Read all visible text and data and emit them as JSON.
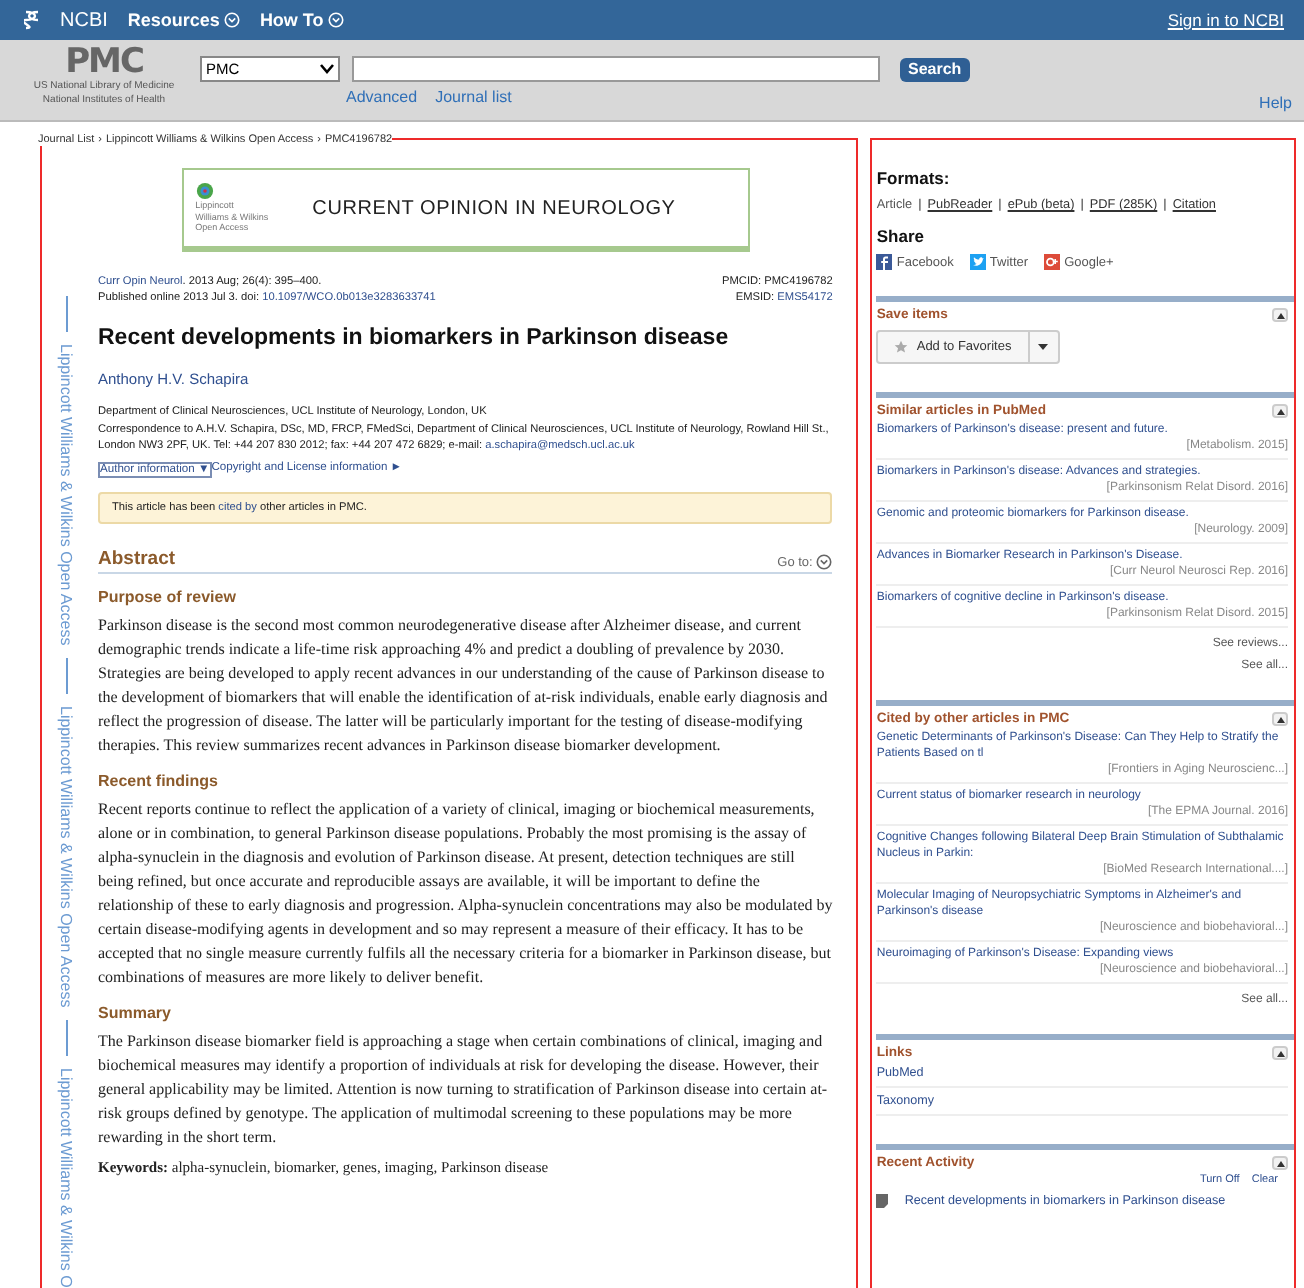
{
  "top_bar": {
    "brand": "NCBI",
    "menus": [
      "Resources",
      "How To"
    ],
    "sign_in": "Sign in to NCBI"
  },
  "search_bar": {
    "logo": "PMC",
    "org_lines": [
      "US National Library of Medicine",
      "National Institutes of Health"
    ],
    "database": "PMC",
    "button": "Search",
    "links": [
      "Advanced",
      "Journal list"
    ],
    "help": "Help"
  },
  "breadcrumb": {
    "items": [
      "Journal List",
      "Lippincott Williams & Wilkins Open Access",
      "PMC4196782"
    ],
    "separator": "›"
  },
  "side_strip": [
    "Lippincott Williams & Wilkins Open Access",
    "Lippincott Williams & Wilkins Open Access",
    "Lippincott Williams & Wilkins O"
  ],
  "banner": {
    "publisher_lines": [
      "Lippincott",
      "Williams & Wilkins",
      "Open Access"
    ],
    "journal": "CURRENT OPINION IN NEUROLOGY"
  },
  "citation": {
    "journal_link": "Curr Opin Neurol",
    "details": ". 2013 Aug; 26(4): 395–400.",
    "published": "Published online 2013 Jul 3. doi: ",
    "doi": "10.1097/WCO.0b013e3283633741",
    "pmcid": "PMCID: PMC4196782",
    "emsid_label": "EMSID: ",
    "emsid": "EMS54172"
  },
  "article": {
    "title": "Recent developments in biomarkers in Parkinson disease",
    "author": "Anthony H.V. Schapira",
    "affiliation": "Department of Clinical Neurosciences, UCL Institute of Neurology, London, UK",
    "correspondence": "Correspondence to A.H.V. Schapira, DSc, MD, FRCP, FMedSci, Department of Clinical Neurosciences, UCL Institute of Neurology, Rowland Hill St., London NW3 2PF, UK. Tel: +44 207 830 2012; fax: +44 207 472 6829; e-mail: ",
    "email": "a.schapira@medsch.ucl.ac.uk",
    "author_info": "Author information ▼",
    "copyright": "Copyright and License information ►",
    "cited_notice": {
      "before": "This article has been ",
      "link": "cited by",
      "after": " other articles in PMC."
    }
  },
  "abstract": {
    "heading": "Abstract",
    "goto": "Go to:",
    "sections": [
      {
        "heading": "Purpose of review",
        "text": "Parkinson disease is the second most common neurodegenerative disease after Alzheimer disease, and current demographic trends indicate a life-time risk approaching 4% and predict a doubling of prevalence by 2030. Strategies are being developed to apply recent advances in our understanding of the cause of Parkinson disease to the development of biomarkers that will enable the identification of at-risk individuals, enable early diagnosis and reflect the progression of disease. The latter will be particularly important for the testing of disease-modifying therapies. This review summarizes recent advances in Parkinson disease biomarker development."
      },
      {
        "heading": "Recent findings",
        "text": "Recent reports continue to reflect the application of a variety of clinical, imaging or biochemical measurements, alone or in combination, to general Parkinson disease populations. Probably the most promising is the assay of alpha-synuclein in the diagnosis and evolution of Parkinson disease. At present, detection techniques are still being refined, but once accurate and reproducible assays are available, it will be important to define the relationship of these to early diagnosis and progression. Alpha-synuclein concentrations may also be modulated by certain disease-modifying agents in development and so may represent a measure of their efficacy. It has to be accepted that no single measure currently fulfils all the necessary criteria for a biomarker in Parkinson disease, but combinations of measures are more likely to deliver benefit."
      },
      {
        "heading": "Summary",
        "text": "The Parkinson disease biomarker field is approaching a stage when certain combinations of clinical, imaging and biochemical measures may identify a proportion of individuals at risk for developing the disease. However, their general applicability may be limited. Attention is now turning to stratification of Parkinson disease into certain at-risk groups defined by genotype. The application of multimodal screening to these populations may be more rewarding in the short term."
      }
    ],
    "keywords": "**Keywords:** alpha-synuclein, biomarker, genes, imaging, Parkinson disease"
  },
  "sidebar": {
    "formats": {
      "heading": "Formats:",
      "separator": "|",
      "items": [
        {
          "label": "Article",
          "selected": true
        },
        {
          "label": "PubReader",
          "selected": false
        },
        {
          "label": "ePub (beta)",
          "selected": false
        },
        {
          "label": "PDF (285K)",
          "selected": false
        },
        {
          "label": "Citation",
          "selected": false
        }
      ]
    },
    "share": {
      "heading": "Share",
      "items": [
        {
          "kind": "facebook",
          "label": "Facebook"
        },
        {
          "kind": "twitter",
          "label": "Twitter"
        },
        {
          "kind": "google",
          "label": "Google+"
        }
      ]
    },
    "save_items": {
      "heading": "Save items",
      "button": "Add to Favorites"
    },
    "similar": {
      "heading": "Similar articles in PubMed",
      "items": [
        {
          "title": "Biomarkers of Parkinson's disease: present and future.",
          "source": "[Metabolism. 2015]"
        },
        {
          "title": "Biomarkers in Parkinson's disease: Advances and strategies.",
          "source": "[Parkinsonism Relat Disord. 2016]"
        },
        {
          "title": "Genomic and proteomic biomarkers for Parkinson disease.",
          "source": "[Neurology. 2009]"
        },
        {
          "title": "Advances in Biomarker Research in Parkinson's Disease.",
          "source": "[Curr Neurol Neurosci Rep. 2016]"
        },
        {
          "title": "Biomarkers of cognitive decline in Parkinson's disease.",
          "source": "[Parkinsonism Relat Disord. 2015]"
        }
      ],
      "more": [
        "See reviews...",
        "See all..."
      ]
    },
    "cited_by": {
      "heading": "Cited by other articles in PMC",
      "items": [
        {
          "title": "Genetic Determinants of Parkinson's Disease: Can They Help to Stratify the Patients Based on tl",
          "source": "[Frontiers in Aging Neuroscienc...]"
        },
        {
          "title": "Current status of biomarker research in neurology",
          "source": "[The EPMA Journal. 2016]"
        },
        {
          "title": "Cognitive Changes following Bilateral Deep Brain Stimulation of Subthalamic Nucleus in Parkin:",
          "source": "[BioMed Research International....]"
        },
        {
          "title": "Molecular Imaging of Neuropsychiatric Symptoms in Alzheimer's and Parkinson's disease",
          "source": "[Neuroscience and biobehavioral...]"
        },
        {
          "title": "Neuroimaging of Parkinson's Disease: Expanding views",
          "source": "[Neuroscience and biobehavioral...]"
        }
      ],
      "more": [
        "See all..."
      ]
    },
    "links": {
      "heading": "Links",
      "items": [
        "PubMed",
        "Taxonomy"
      ]
    },
    "recent": {
      "heading": "Recent Activity",
      "actions": [
        "Turn Off",
        "Clear"
      ],
      "items": [
        "Recent developments in biomarkers in Parkinson disease"
      ]
    }
  }
}
